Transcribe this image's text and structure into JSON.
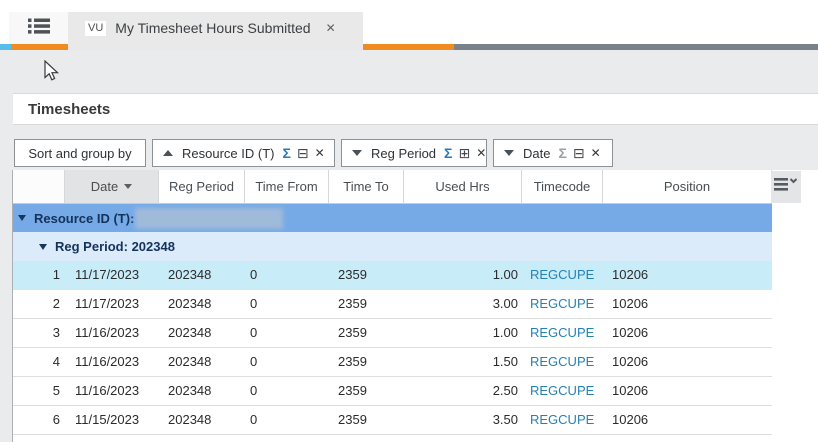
{
  "tab_bar": {
    "app_badge": "VU",
    "title": "My Timesheet Hours Submitted",
    "close_glyph": "✕"
  },
  "panel": {
    "title": "Timesheets"
  },
  "toolbar": {
    "sort_button_label": "Sort and group by",
    "groups": [
      {
        "label": "Resource ID (T)",
        "sort": "asc",
        "sigma": "Σ",
        "collapse_glyph": "⊟",
        "close_glyph": "✕",
        "sigma_active": true
      },
      {
        "label": "Reg Period",
        "sort": "desc",
        "sigma": "Σ",
        "collapse_glyph": "⊞",
        "close_glyph": "✕",
        "sigma_active": true
      },
      {
        "label": "Date",
        "sort": "desc",
        "sigma": "Σ",
        "collapse_glyph": "⊟",
        "close_glyph": "✕",
        "sigma_active": false
      }
    ]
  },
  "grid": {
    "columns": [
      "Date",
      "Reg Period",
      "Time From",
      "Time To",
      "Used Hrs",
      "Timecode",
      "Position"
    ],
    "sorted_column": "Date",
    "group_rows": {
      "resource_label": "Resource ID (T):",
      "reg_period_label": "Reg Period: 202348"
    },
    "selected_row_index": 0,
    "rows": [
      {
        "num": "1",
        "date": "11/17/2023",
        "reg_period": "202348",
        "time_from": "0",
        "time_to": "2359",
        "used_hrs": "1.00",
        "timecode": "REGCUPE",
        "position": "10206"
      },
      {
        "num": "2",
        "date": "11/17/2023",
        "reg_period": "202348",
        "time_from": "0",
        "time_to": "2359",
        "used_hrs": "3.00",
        "timecode": "REGCUPE",
        "position": "10206"
      },
      {
        "num": "3",
        "date": "11/16/2023",
        "reg_period": "202348",
        "time_from": "0",
        "time_to": "2359",
        "used_hrs": "1.00",
        "timecode": "REGCUPE",
        "position": "10206"
      },
      {
        "num": "4",
        "date": "11/16/2023",
        "reg_period": "202348",
        "time_from": "0",
        "time_to": "2359",
        "used_hrs": "1.50",
        "timecode": "REGCUPE",
        "position": "10206"
      },
      {
        "num": "5",
        "date": "11/16/2023",
        "reg_period": "202348",
        "time_from": "0",
        "time_to": "2359",
        "used_hrs": "2.50",
        "timecode": "REGCUPE",
        "position": "10206"
      },
      {
        "num": "6",
        "date": "11/15/2023",
        "reg_period": "202348",
        "time_from": "0",
        "time_to": "2359",
        "used_hrs": "3.50",
        "timecode": "REGCUPE",
        "position": "10206"
      }
    ]
  },
  "colors": {
    "accent_orange": "#f08a21",
    "accent_cyan": "#55bde8",
    "slate_bar": "#79828b",
    "group_row_blue": "#76aae7",
    "group_row_light_blue": "#dcebfa",
    "selected_row_cyan": "#c9ecf9",
    "link_blue": "#2581b4",
    "sigma_blue": "#2779bd",
    "sigma_gray": "#9aa0a4"
  }
}
